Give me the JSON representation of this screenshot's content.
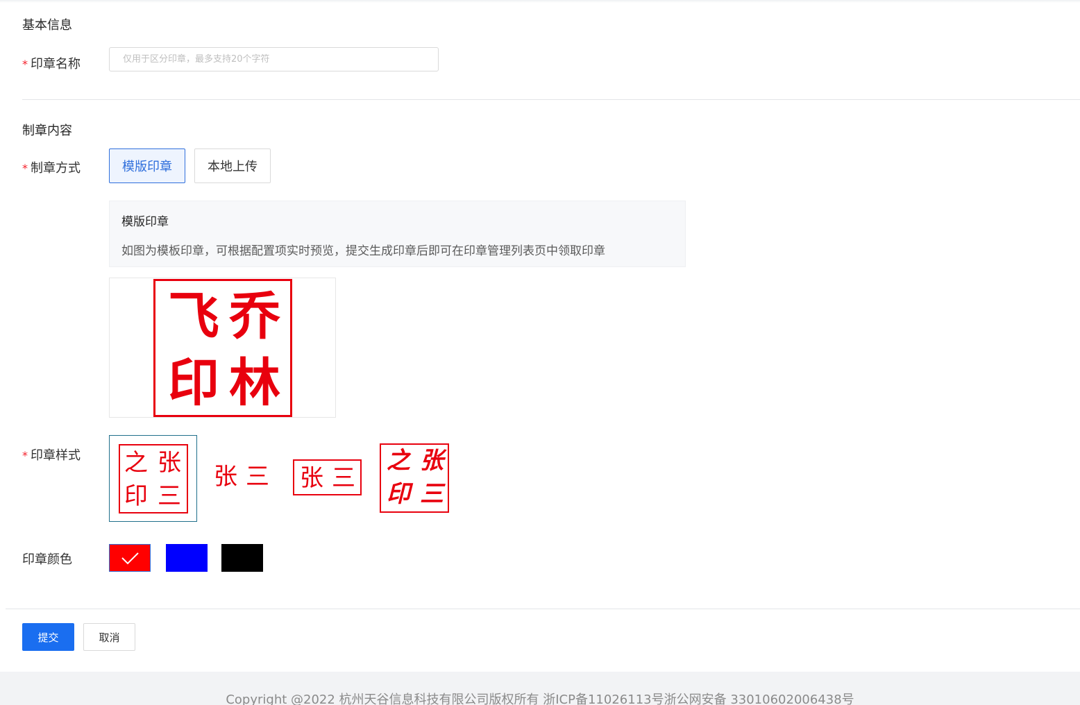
{
  "basic_info": {
    "title": "基本信息",
    "seal_name_label": "印章名称",
    "seal_name_placeholder": "仅用于区分印章，最多支持20个字符",
    "seal_name_value": ""
  },
  "content": {
    "title": "制章内容",
    "method_label": "制章方式",
    "methods": [
      {
        "label": "模版印章",
        "active": true
      },
      {
        "label": "本地上传",
        "active": false
      }
    ],
    "info_box": {
      "title": "模版印章",
      "description": "如图为模板印章，可根据配置项实时预览，提交生成印章后即可在印章管理列表页中领取印章"
    },
    "preview_seal": {
      "chars": [
        "飞",
        "乔",
        "印",
        "林"
      ]
    },
    "style_label": "印章样式",
    "styles": [
      {
        "chars": [
          "之",
          "张",
          "印",
          "三"
        ],
        "selected": true
      },
      {
        "chars": [
          "张",
          "三"
        ],
        "selected": false
      },
      {
        "chars": [
          "张",
          "三"
        ],
        "selected": false
      },
      {
        "chars": [
          "之",
          "张",
          "印",
          "三"
        ],
        "selected": false
      }
    ],
    "color_label": "印章颜色",
    "colors": [
      {
        "name": "red",
        "hex": "#ff0000",
        "selected": true
      },
      {
        "name": "blue",
        "hex": "#0000ff",
        "selected": false
      },
      {
        "name": "black",
        "hex": "#000000",
        "selected": false
      }
    ]
  },
  "actions": {
    "submit_label": "提交",
    "cancel_label": "取消"
  },
  "footer": {
    "copyright": "Copyright @2022 杭州天谷信息科技有限公司版权所有 浙ICP备11026113号浙公网安备 33010602006438号"
  },
  "theme": {
    "primary": "#1a6ef0",
    "seal_red": "#e8000e",
    "required": "#f5222d"
  }
}
